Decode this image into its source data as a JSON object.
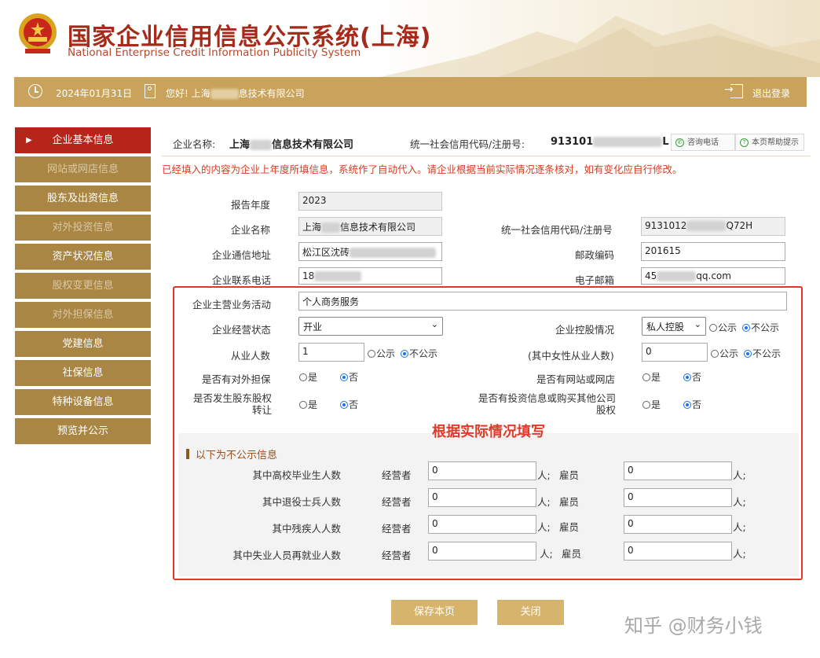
{
  "header": {
    "title_cn": "国家企业信用信息公示系统(上海)",
    "title_en": "National Enterprise Credit Information Publicity System"
  },
  "topbar": {
    "date": "2024年01月31日",
    "greeting": "您好! 上海",
    "greeting_suffix": "息技术有限公司",
    "logout": "退出登录"
  },
  "sidebar": {
    "items": [
      {
        "label": "企业基本信息",
        "state": "active"
      },
      {
        "label": "网站或网店信息",
        "state": "dim"
      },
      {
        "label": "股东及出资信息",
        "state": "normal"
      },
      {
        "label": "对外投资信息",
        "state": "dim"
      },
      {
        "label": "资产状况信息",
        "state": "normal"
      },
      {
        "label": "股权变更信息",
        "state": "dim"
      },
      {
        "label": "对外担保信息",
        "state": "dim"
      },
      {
        "label": "党建信息",
        "state": "normal"
      },
      {
        "label": "社保信息",
        "state": "normal"
      },
      {
        "label": "特种设备信息",
        "state": "normal"
      },
      {
        "label": "预览并公示",
        "state": "normal"
      }
    ]
  },
  "infobar": {
    "name_label": "企业名称:",
    "name_prefix": "上海",
    "name_suffix": "信息技术有限公司",
    "code_label": "统一社会信用代码/注册号:",
    "code_prefix": "913101",
    "code_tail": "L",
    "consult_button": "咨询电话",
    "help_button": "本页帮助提示"
  },
  "notice": "已经填入的内容为企业上年度所填信息，系统作了自动代入。请企业根据当前实际情况逐条核对，如有变化应自行修改。",
  "form": {
    "report_year_label": "报告年度",
    "report_year": "2023",
    "company_name_label": "企业名称",
    "company_name_prefix": "上海",
    "company_name_suffix": "信息技术有限公司",
    "credit_code_label": "统一社会信用代码/注册号",
    "credit_code_prefix": "9131012",
    "credit_code_suffix": "Q72H",
    "address_label": "企业通信地址",
    "address_prefix": "松江区沈砖",
    "postcode_label": "邮政编码",
    "postcode": "201615",
    "phone_label": "企业联系电话",
    "phone_prefix": "18",
    "email_label": "电子邮箱",
    "email_prefix": "45",
    "email_suffix": "qq.com",
    "business_label": "企业主营业务活动",
    "business": "个人商务服务",
    "status_label": "企业经营状态",
    "status": "开业",
    "holding_label": "企业控股情况",
    "holding": "私人控股",
    "employees_label": "从业人数",
    "employees": "1",
    "female_label": "(其中女性从业人数)",
    "female": "0",
    "guarantee_label": "是否有对外担保",
    "website_label": "是否有网站或网店",
    "transfer_label": "是否发生股东股权转让",
    "invest_label": "是否有投资信息或购买其他公司股权",
    "opt_public": "公示",
    "opt_private": "不公示",
    "opt_yes": "是",
    "opt_no": "否"
  },
  "hint": "根据实际情况填写",
  "private_section": {
    "title": "以下为不公示信息",
    "operator_label": "经营者",
    "employee_label": "雇员",
    "unit": "人;",
    "rows": [
      {
        "label": "其中高校毕业生人数",
        "operator": "0",
        "employee": "0"
      },
      {
        "label": "其中退役士兵人数",
        "operator": "0",
        "employee": "0"
      },
      {
        "label": "其中残疾人人数",
        "operator": "0",
        "employee": "0"
      },
      {
        "label": "其中失业人员再就业人数",
        "operator": "0",
        "employee": "0"
      }
    ]
  },
  "buttons": {
    "save": "保存本页",
    "close": "关闭"
  },
  "watermark": "知乎 @财务小钱"
}
